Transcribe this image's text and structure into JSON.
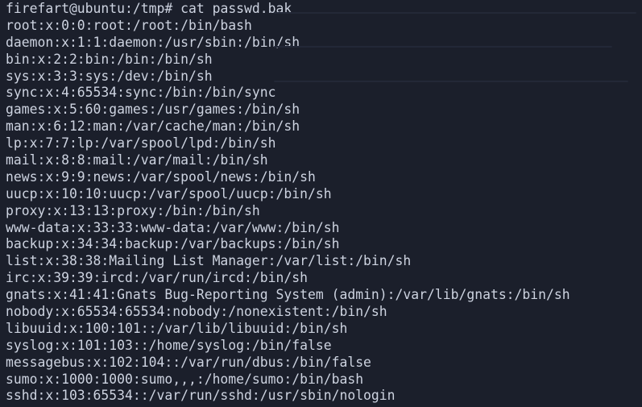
{
  "terminal": {
    "prompt": "firefart@ubuntu:/tmp#",
    "command": "cat passwd.bak",
    "output": [
      "root:x:0:0:root:/root:/bin/bash",
      "daemon:x:1:1:daemon:/usr/sbin:/bin/sh",
      "bin:x:2:2:bin:/bin:/bin/sh",
      "sys:x:3:3:sys:/dev:/bin/sh",
      "sync:x:4:65534:sync:/bin:/bin/sync",
      "games:x:5:60:games:/usr/games:/bin/sh",
      "man:x:6:12:man:/var/cache/man:/bin/sh",
      "lp:x:7:7:lp:/var/spool/lpd:/bin/sh",
      "mail:x:8:8:mail:/var/mail:/bin/sh",
      "news:x:9:9:news:/var/spool/news:/bin/sh",
      "uucp:x:10:10:uucp:/var/spool/uucp:/bin/sh",
      "proxy:x:13:13:proxy:/bin:/bin/sh",
      "www-data:x:33:33:www-data:/var/www:/bin/sh",
      "backup:x:34:34:backup:/var/backups:/bin/sh",
      "list:x:38:38:Mailing List Manager:/var/list:/bin/sh",
      "irc:x:39:39:ircd:/var/run/ircd:/bin/sh",
      "gnats:x:41:41:Gnats Bug-Reporting System (admin):/var/lib/gnats:/bin/sh",
      "nobody:x:65534:65534:nobody:/nonexistent:/bin/sh",
      "libuuid:x:100:101::/var/lib/libuuid:/bin/sh",
      "syslog:x:101:103::/home/syslog:/bin/false",
      "messagebus:x:102:104::/var/run/dbus:/bin/false",
      "sumo:x:1000:1000:sumo,,,:/home/sumo:/bin/bash",
      "sshd:x:103:65534::/var/run/sshd:/usr/sbin/nologin"
    ]
  },
  "colors": {
    "background": "#1b1f2b",
    "foreground": "#cdd3e0"
  }
}
